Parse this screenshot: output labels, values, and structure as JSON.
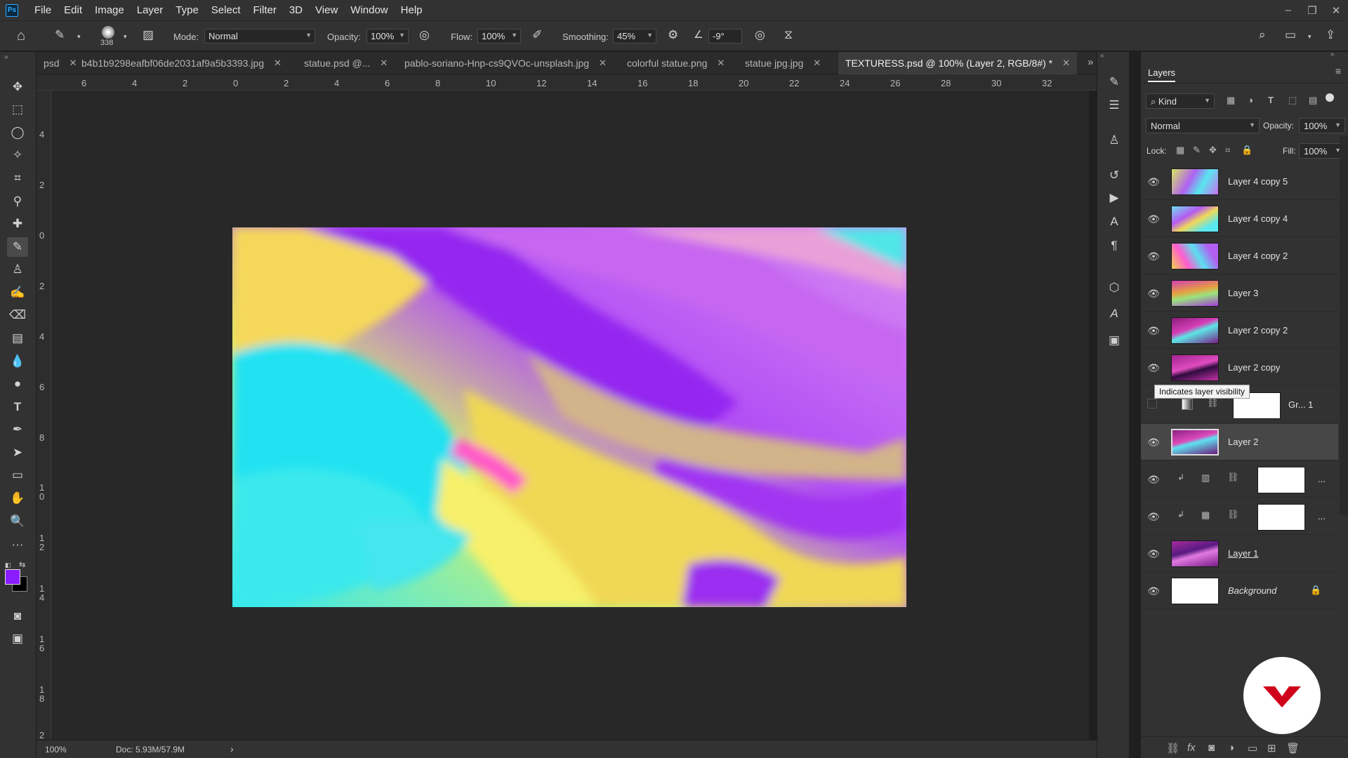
{
  "menu": {
    "items": [
      "File",
      "Edit",
      "Image",
      "Layer",
      "Type",
      "Select",
      "Filter",
      "3D",
      "View",
      "Window",
      "Help"
    ]
  },
  "options": {
    "brush_size": "338",
    "mode_label": "Mode:",
    "mode_value": "Normal",
    "opacity_label": "Opacity:",
    "opacity_value": "100%",
    "flow_label": "Flow:",
    "flow_value": "100%",
    "smoothing_label": "Smoothing:",
    "smoothing_value": "45%",
    "angle_value": "-9°"
  },
  "tabs": [
    {
      "label": "psd"
    },
    {
      "label": "b4b1b9298eafbf06de2031af9a5b3393.jpg"
    },
    {
      "label": "statue.psd @..."
    },
    {
      "label": "pablo-soriano-Hnp-cs9QVOc-unsplash.jpg"
    },
    {
      "label": "colorful statue.png"
    },
    {
      "label": "statue jpg.jpg"
    },
    {
      "label": "TEXTURESS.psd @ 100% (Layer 2, RGB/8#) *"
    }
  ],
  "ruler": {
    "h_labels": [
      "6",
      "4",
      "2",
      "0",
      "2",
      "4",
      "6",
      "8",
      "10",
      "12",
      "14",
      "16",
      "18",
      "20",
      "22",
      "24",
      "26",
      "28",
      "30",
      "32"
    ],
    "v_labels": [
      "4",
      "2",
      "0",
      "2",
      "4",
      "6",
      "8",
      "1\n0",
      "1\n2",
      "1\n4",
      "1\n6",
      "1\n8",
      "2"
    ]
  },
  "status": {
    "zoom": "100%",
    "doc": "Doc: 5.93M/57.9M",
    "arrow": "›"
  },
  "layers_panel": {
    "title": "Layers",
    "filter_value": "Kind",
    "blend_value": "Normal",
    "opacity_label": "Opacity:",
    "opacity_value": "100%",
    "lock_label": "Lock:",
    "fill_label": "Fill:",
    "fill_value": "100%",
    "tooltip": "Indicates layer visibility",
    "layers": [
      {
        "name": "Layer 4 copy 5"
      },
      {
        "name": "Layer 4 copy 4"
      },
      {
        "name": "Layer 4 copy 2"
      },
      {
        "name": "Layer 3"
      },
      {
        "name": "Layer 2 copy 2"
      },
      {
        "name": "Layer 2 copy"
      },
      {
        "name": "Gr... 1"
      },
      {
        "name": "Layer 2"
      },
      {
        "name": "..."
      },
      {
        "name": "..."
      },
      {
        "name": "Layer 1"
      },
      {
        "name": "Background"
      }
    ]
  },
  "colors": {
    "foreground": "#8a1cff",
    "background": "#000000",
    "accent": "#31a8ff",
    "badge": "#d0021b"
  }
}
